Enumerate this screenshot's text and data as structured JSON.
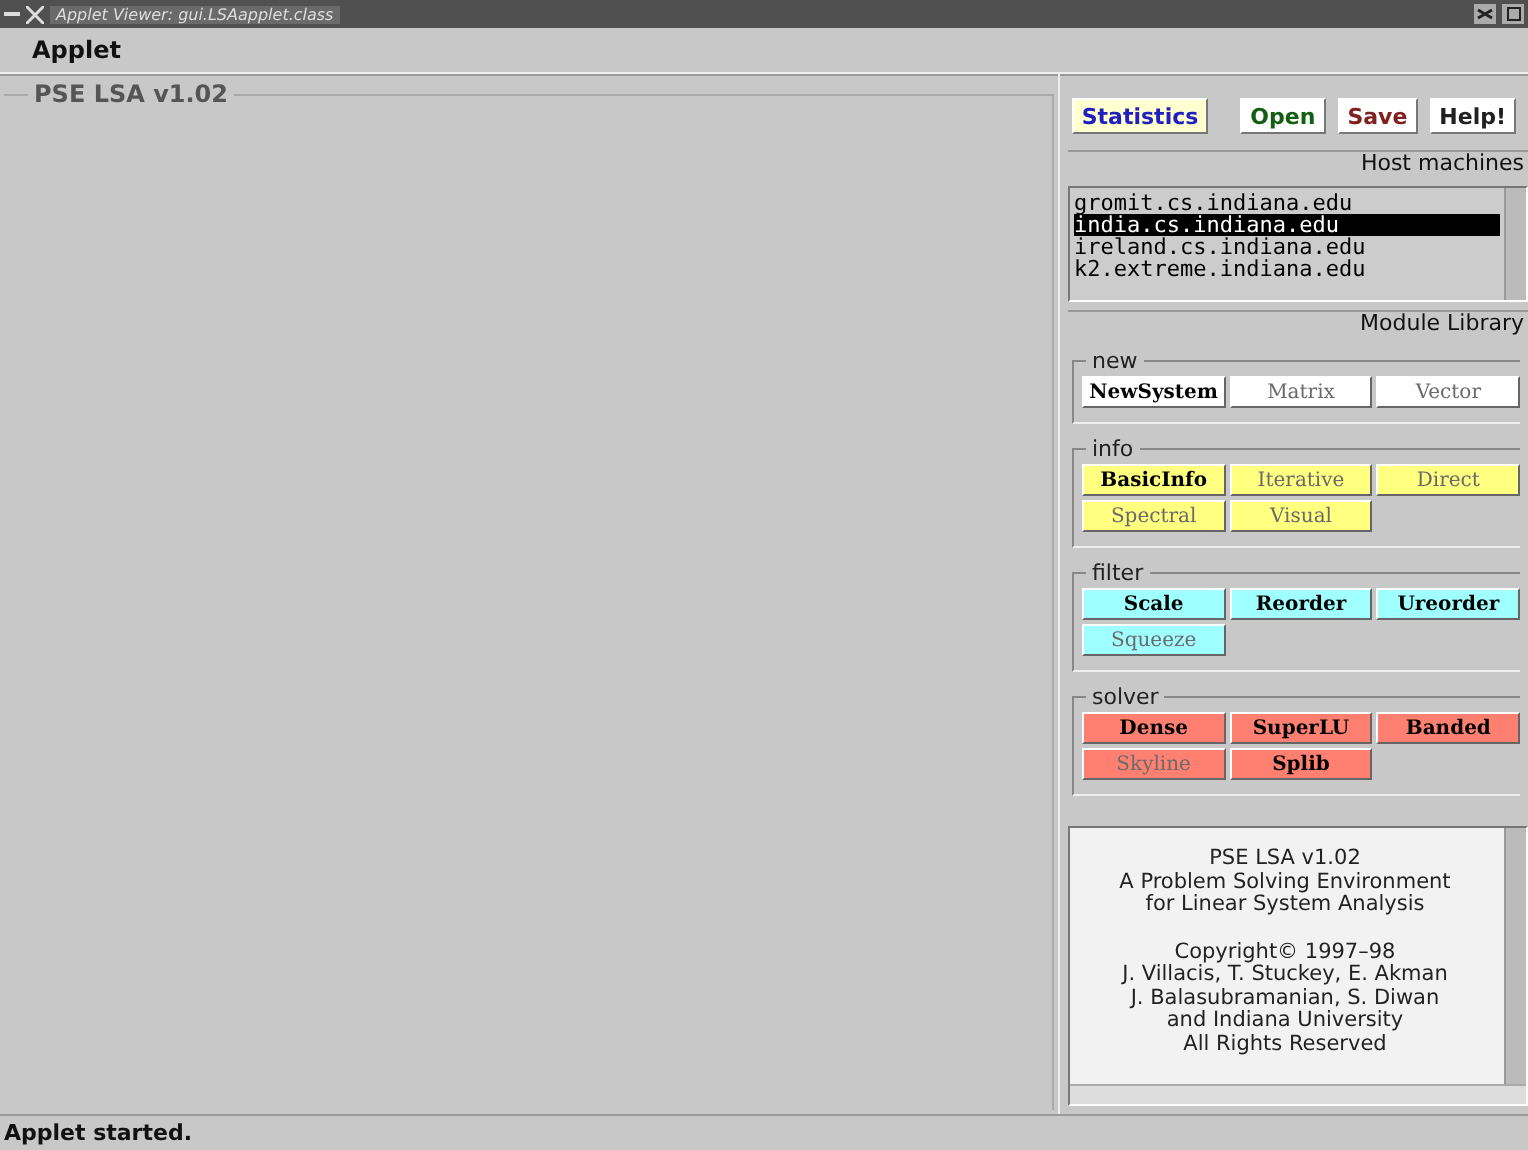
{
  "window": {
    "title": "Applet Viewer: gui.LSAapplet.class"
  },
  "menu": [
    "Applet"
  ],
  "workspace": {
    "title": "PSE LSA v1.02"
  },
  "toolbar": [
    {
      "label": "Statistics",
      "color": "#2020c0",
      "default": true
    },
    {
      "label": "Open",
      "color": "#106010",
      "default": false
    },
    {
      "label": "Save",
      "color": "#802020",
      "default": false
    },
    {
      "label": "Help!",
      "color": "#202020",
      "default": false
    }
  ],
  "hosts": {
    "title": "Host machines",
    "items": [
      {
        "label": "gromit.cs.indiana.edu",
        "selected": false
      },
      {
        "label": "india.cs.indiana.edu",
        "selected": true
      },
      {
        "label": "ireland.cs.indiana.edu",
        "selected": false
      },
      {
        "label": "k2.extreme.indiana.edu",
        "selected": false
      }
    ]
  },
  "library": {
    "title": "Module Library",
    "groups": [
      {
        "name": "new",
        "color": "#ffffff",
        "items": [
          {
            "label": "NewSystem",
            "enabled": true
          },
          {
            "label": "Matrix",
            "enabled": false
          },
          {
            "label": "Vector",
            "enabled": false
          }
        ]
      },
      {
        "name": "info",
        "color": "#ffff80",
        "items": [
          {
            "label": "BasicInfo",
            "enabled": true
          },
          {
            "label": "Iterative",
            "enabled": false
          },
          {
            "label": "Direct",
            "enabled": false
          },
          {
            "label": "Spectral",
            "enabled": false
          },
          {
            "label": "Visual",
            "enabled": false
          }
        ]
      },
      {
        "name": "filter",
        "color": "#a0ffff",
        "items": [
          {
            "label": "Scale",
            "enabled": true
          },
          {
            "label": "Reorder",
            "enabled": true
          },
          {
            "label": "Ureorder",
            "enabled": true
          },
          {
            "label": "Squeeze",
            "enabled": false
          }
        ]
      },
      {
        "name": "solver",
        "color": "#ff8070",
        "items": [
          {
            "label": "Dense",
            "enabled": true
          },
          {
            "label": "SuperLU",
            "enabled": true
          },
          {
            "label": "Banded",
            "enabled": true
          },
          {
            "label": "Skyline",
            "enabled": false
          },
          {
            "label": "Splib",
            "enabled": true
          }
        ]
      }
    ]
  },
  "about": {
    "paragraphs": [
      [
        "PSE LSA v1.02",
        "A Problem Solving Environment",
        "for Linear System Analysis"
      ],
      [
        "Copyright© 1997–98",
        "J. Villacis, T. Stuckey, E. Akman",
        "J. Balasubramanian, S. Diwan",
        "and Indiana University",
        "All Rights Reserved"
      ]
    ]
  },
  "status_bar": "Applet started."
}
